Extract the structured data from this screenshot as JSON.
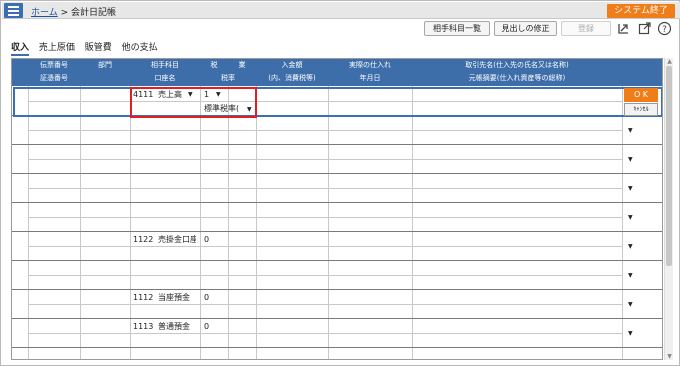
{
  "topbar": {
    "home_link": "ホーム",
    "crumb_separator": ">",
    "page_title": "会計日記帳",
    "system_exit": "システム終了"
  },
  "toolbar": {
    "counter_account_list": "相手科目一覧",
    "heading_fix": "見出しの修正",
    "register": "登録",
    "icons": [
      "export-icon",
      "open-window-icon",
      "help-icon"
    ]
  },
  "tabs": [
    {
      "label": "収入",
      "active": true
    },
    {
      "label": "売上原価",
      "active": false
    },
    {
      "label": "販管費",
      "active": false
    },
    {
      "label": "他の支払",
      "active": false
    }
  ],
  "headers": {
    "row1": [
      "伝票番号",
      "部門",
      "相手科目",
      "税",
      "業",
      "入金額",
      "実際の仕入れ",
      "取引先名(仕入先の氏名又は名称)"
    ],
    "row2": [
      "証憑番号",
      "口座名",
      "税率",
      "(内、消費税等)",
      "年月日",
      "元帳摘要(仕入れ資産等の総称)"
    ]
  },
  "rows": [
    {
      "account_code": "4111",
      "account_name": "売上高",
      "tax": "1",
      "tax_rate": "標準税率(",
      "editing": true
    },
    {
      "account_code": "",
      "account_name": "",
      "tax": "",
      "tax_rate": ""
    },
    {
      "account_code": "",
      "account_name": "",
      "tax": "",
      "tax_rate": ""
    },
    {
      "account_code": "",
      "account_name": "",
      "tax": "",
      "tax_rate": ""
    },
    {
      "account_code": "",
      "account_name": "",
      "tax": "",
      "tax_rate": ""
    },
    {
      "account_code": "1122",
      "account_name": "売掛金口座",
      "tax": "0",
      "tax_rate": ""
    },
    {
      "account_code": "",
      "account_name": "",
      "tax": "",
      "tax_rate": ""
    },
    {
      "account_code": "1112",
      "account_name": "当座預金",
      "tax": "0",
      "tax_rate": ""
    },
    {
      "account_code": "1113",
      "account_name": "普通預金",
      "tax": "0",
      "tax_rate": ""
    }
  ],
  "row_actions": {
    "ok": "O K",
    "cancel": "ｷｬﾝｾﾙ"
  },
  "dropdown_caret": "▼"
}
